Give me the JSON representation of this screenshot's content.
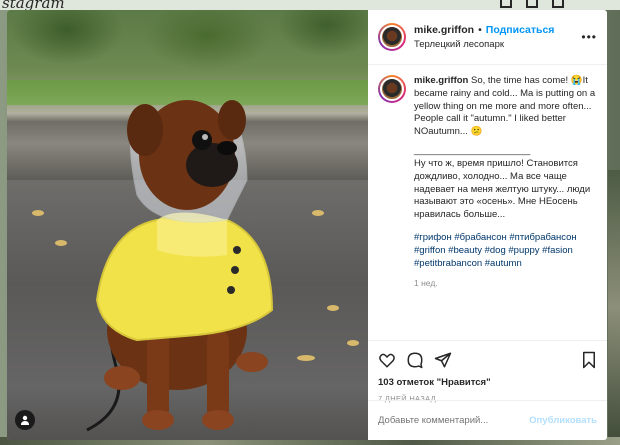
{
  "background": {
    "logo": "stagram"
  },
  "post": {
    "username": "mike.griffon",
    "follow_label": "Подписаться",
    "dot": "•",
    "location": "Терлецкий лесопарк",
    "more_icon": "more-horizontal-icon",
    "caption": {
      "username": "mike.griffon",
      "english": "So, the time has come! 😭It became rainy and cold... Ma is putting on a yellow thing on me more and more often... People call it \"autumn.\" I liked better NOautumn... 😕",
      "divider": "______________________",
      "russian": "Ну что ж, время пришло! Становится дождливо, холодно... Ма все чаще надевает на меня желтую штуку... люди называют это «осень». Мне НЕосень нравилась больше...",
      "hashtags": "#грифон #брабансон #птибрабансон #griffon #beauty #dog #puppy #fasion #petitbrabancon #autumn",
      "time_ago": "1 нед."
    },
    "likes": "103 отметок \"Нравится\"",
    "date": "7 ДНЕЙ НАЗАД",
    "comment_placeholder": "Добавьте комментарий...",
    "publish_label": "Опубликовать"
  },
  "colors": {
    "accent": "#0095f6",
    "publish_disabled": "#b2dffc",
    "raincoat": "#f2e24a"
  }
}
